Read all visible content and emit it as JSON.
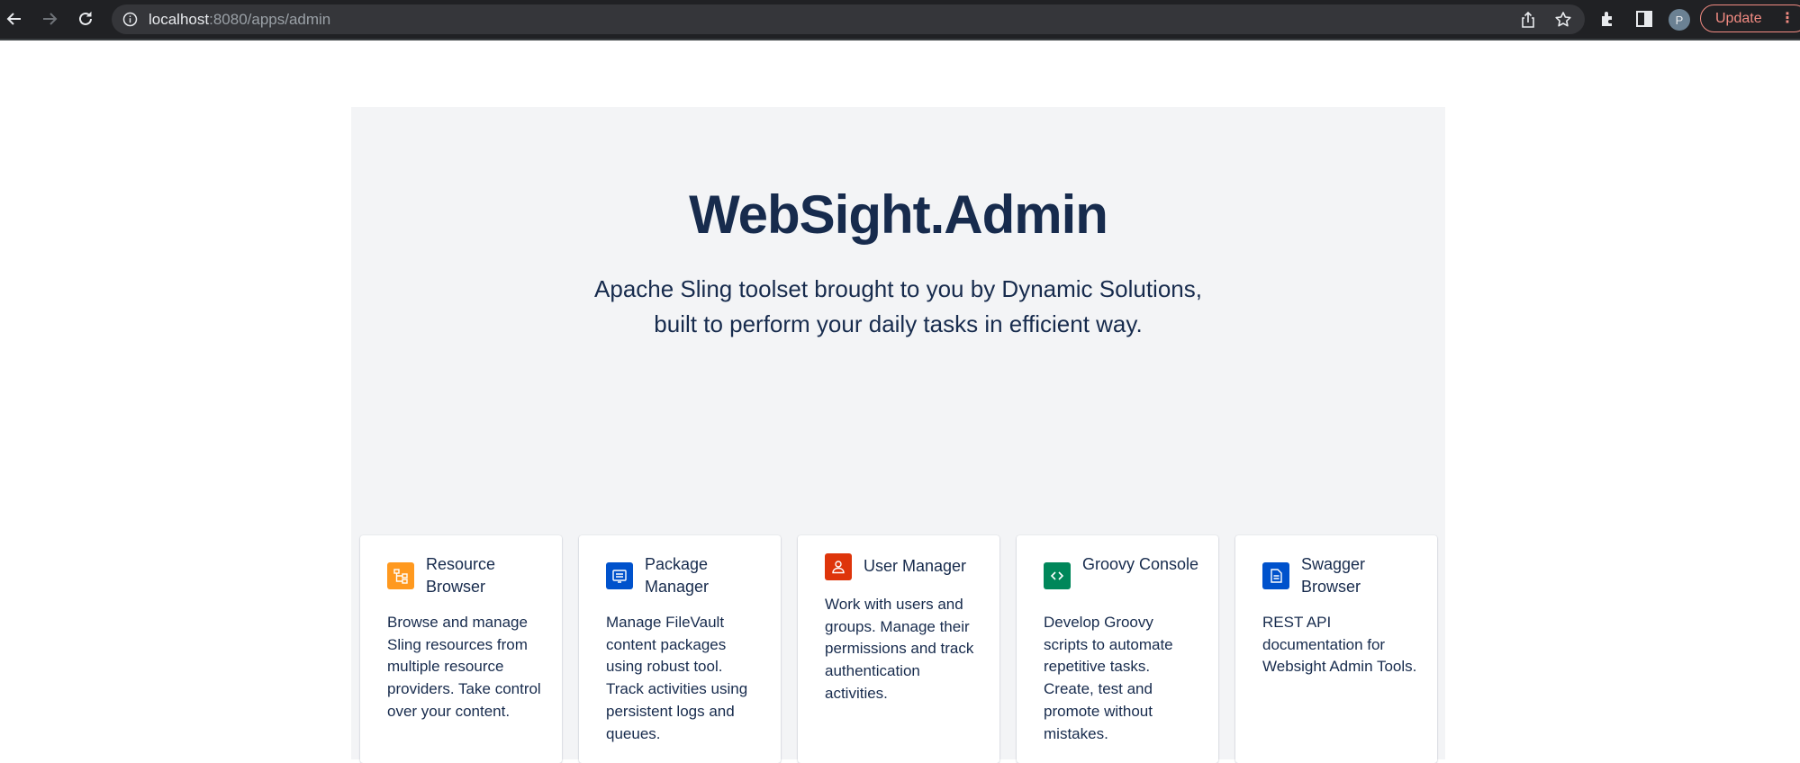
{
  "browser": {
    "url_host": "localhost",
    "url_path": ":8080/apps/admin",
    "profile_initial": "P",
    "update_label": "Update",
    "menu_glyph": "⋮",
    "icons": [
      "back-icon",
      "forward-icon",
      "reload-icon",
      "info-icon",
      "share-icon",
      "star-icon",
      "extensions-icon",
      "side-panel-icon"
    ]
  },
  "hero": {
    "title": "WebSight.Admin",
    "subtitle_line1": "Apache Sling toolset brought to you by Dynamic Solutions,",
    "subtitle_line2": "built to perform your daily tasks in efficient way."
  },
  "cards": [
    {
      "title": "Resource Browser",
      "description": "Browse and manage Sling resources from multiple resource providers. Take control over your content.",
      "icon": "resource-tree-icon",
      "color": "#ff991f"
    },
    {
      "title": "Package Manager",
      "description": "Manage FileVault content packages using robust tool. Track activities using persistent logs and queues.",
      "icon": "package-icon",
      "color": "#0052cc"
    },
    {
      "title": "User Manager",
      "description": "Work with users and groups. Manage their permissions and track authentication activities.",
      "icon": "user-icon",
      "color": "#de350b"
    },
    {
      "title": "Groovy Console",
      "description": "Develop Groovy scripts to automate repetitive tasks. Create, test and promote without mistakes.",
      "icon": "code-icon",
      "color": "#00875a"
    },
    {
      "title": "Swagger Browser",
      "description": "REST API documentation for Websight Admin Tools.",
      "icon": "document-icon",
      "color": "#0052cc"
    }
  ]
}
